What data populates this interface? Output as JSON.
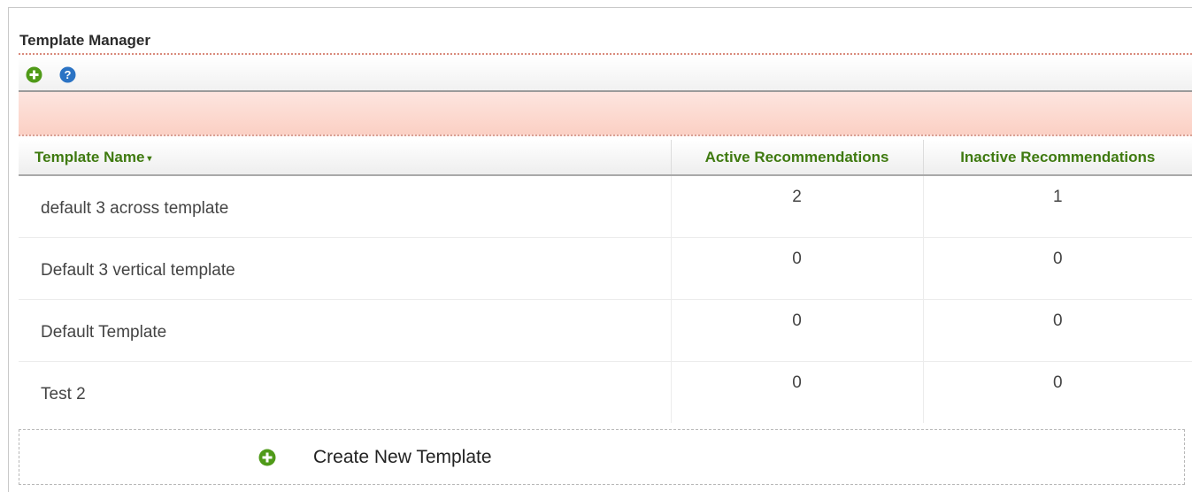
{
  "panel": {
    "title": "Template Manager"
  },
  "toolbar": {
    "icons": [
      "add-icon",
      "help-icon"
    ]
  },
  "table": {
    "columns": {
      "name": "Template Name",
      "active": "Active Recommendations",
      "inactive": "Inactive Recommendations"
    },
    "sort_indicator": "▾",
    "rows": [
      {
        "name": "default 3 across template",
        "active": "2",
        "inactive": "1"
      },
      {
        "name": "Default 3 vertical template",
        "active": "0",
        "inactive": "0"
      },
      {
        "name": "Default Template",
        "active": "0",
        "inactive": "0"
      },
      {
        "name": "Test 2",
        "active": "0",
        "inactive": "0"
      }
    ]
  },
  "create": {
    "label": "Create New Template"
  },
  "colors": {
    "accent_green": "#3f7a10",
    "alert_pink": "#fbd0c4",
    "help_blue": "#2b73c4"
  }
}
